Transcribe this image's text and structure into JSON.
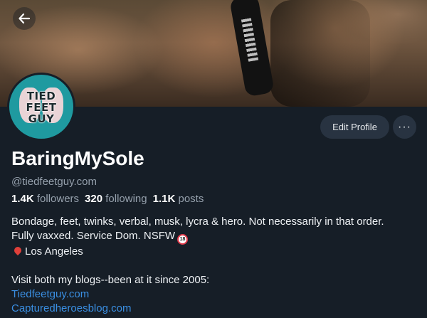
{
  "profile": {
    "avatar_text_line1": "TIED",
    "avatar_text_line2": "FEET",
    "avatar_text_line3": "GUY",
    "display_name": "BaringMySole",
    "handle": "@tiedfeetguy.com",
    "followers_count": "1.4K",
    "followers_label": "followers",
    "following_count": "320",
    "following_label": "following",
    "posts_count": "1.1K",
    "posts_label": "posts"
  },
  "actions": {
    "edit_profile_label": "Edit Profile",
    "more_label": "···"
  },
  "bio": {
    "line1": "Bondage, feet, twinks, verbal, musk, lycra & hero. Not necessarily in that order.",
    "line2": "Fully vaxxed. Service Dom.  NSFW",
    "nsfw_badge": "18",
    "location": "Los Angeles",
    "line4": "Visit both my blogs--been at it since 2005:",
    "link1": "Tiedfeetguy.com",
    "link2": "Capturedheroesblog.com"
  },
  "icons": {
    "back": "arrow-left-icon",
    "pin": "round-pushpin-icon",
    "nsfw": "no-one-under-eighteen-icon"
  },
  "colors": {
    "background": "#161e27",
    "button_bg": "#283341",
    "link": "#3a8fe3",
    "muted_text": "#96a1ad",
    "avatar_bg": "#1f9aa0"
  }
}
